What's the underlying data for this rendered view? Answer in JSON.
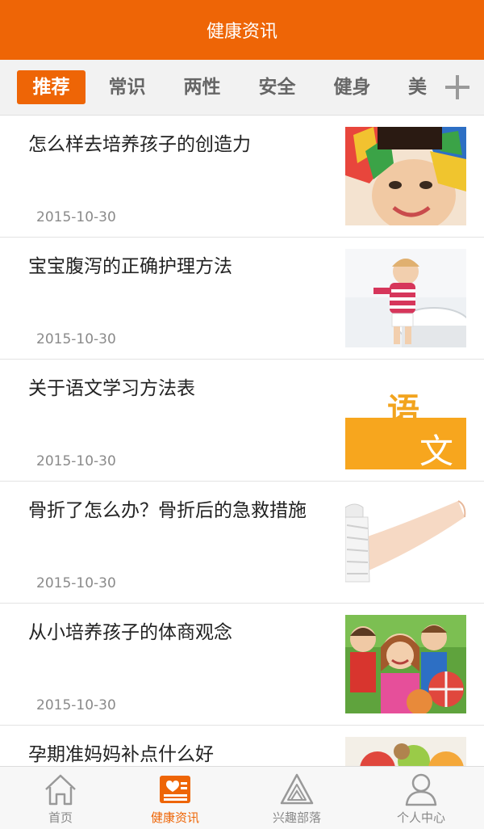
{
  "header": {
    "title": "健康资讯"
  },
  "tabs": [
    {
      "label": "推荐",
      "active": true
    },
    {
      "label": "常识"
    },
    {
      "label": "两性"
    },
    {
      "label": "安全"
    },
    {
      "label": "健身"
    },
    {
      "label": "美"
    }
  ],
  "tab_add_icon": "plus-icon",
  "articles": [
    {
      "title": "怎么样去培养孩子的创造力",
      "date": "2015-10-30"
    },
    {
      "title": "宝宝腹泻的正确护理方法",
      "date": "2015-10-30"
    },
    {
      "title": "关于语文学习方法表",
      "date": "2015-10-30",
      "thumb_text": [
        "语",
        "文"
      ]
    },
    {
      "title": "骨折了怎么办？骨折后的急救措施",
      "date": "2015-10-30"
    },
    {
      "title": "从小培养孩子的体商观念",
      "date": "2015-10-30"
    },
    {
      "title": "孕期准妈妈补点什么好",
      "date": ""
    }
  ],
  "bottom_nav": [
    {
      "label": "首页",
      "icon": "home-icon"
    },
    {
      "label": "健康资讯",
      "icon": "news-icon",
      "active": true
    },
    {
      "label": "兴趣部落",
      "icon": "tribe-icon"
    },
    {
      "label": "个人中心",
      "icon": "user-icon"
    }
  ],
  "colors": {
    "accent": "#EE6506",
    "tab_text": "#666666",
    "date_text": "#8a8a8a",
    "nav_text": "#888888"
  }
}
